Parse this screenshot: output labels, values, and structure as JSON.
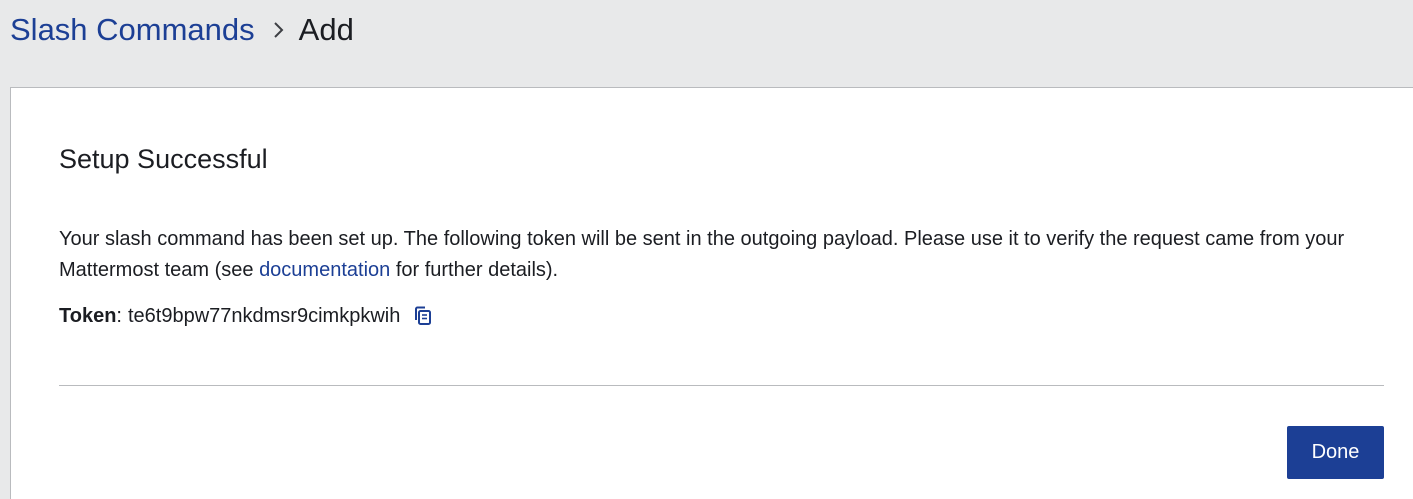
{
  "breadcrumb": {
    "parent_label": "Slash Commands",
    "current_label": "Add",
    "separator_icon": "chevron-right-icon"
  },
  "panel": {
    "title": "Setup Successful",
    "description_before_link": "Your slash command has been set up. The following token will be sent in the outgoing payload. Please use it to verify the request came from your Mattermost team (see ",
    "link_text": "documentation",
    "description_after_link": " for further details).",
    "token_label": "Token",
    "token_colon": ":",
    "token_value": "te6t9bpw77nkdmsr9cimkpkwih",
    "copy_icon": "copy-icon",
    "done_label": "Done"
  },
  "colors": {
    "accent": "#1c3f95",
    "header_bg": "#e8e9ea",
    "panel_bg": "#ffffff",
    "text": "#1b1d22",
    "divider": "#b9bbbe"
  }
}
